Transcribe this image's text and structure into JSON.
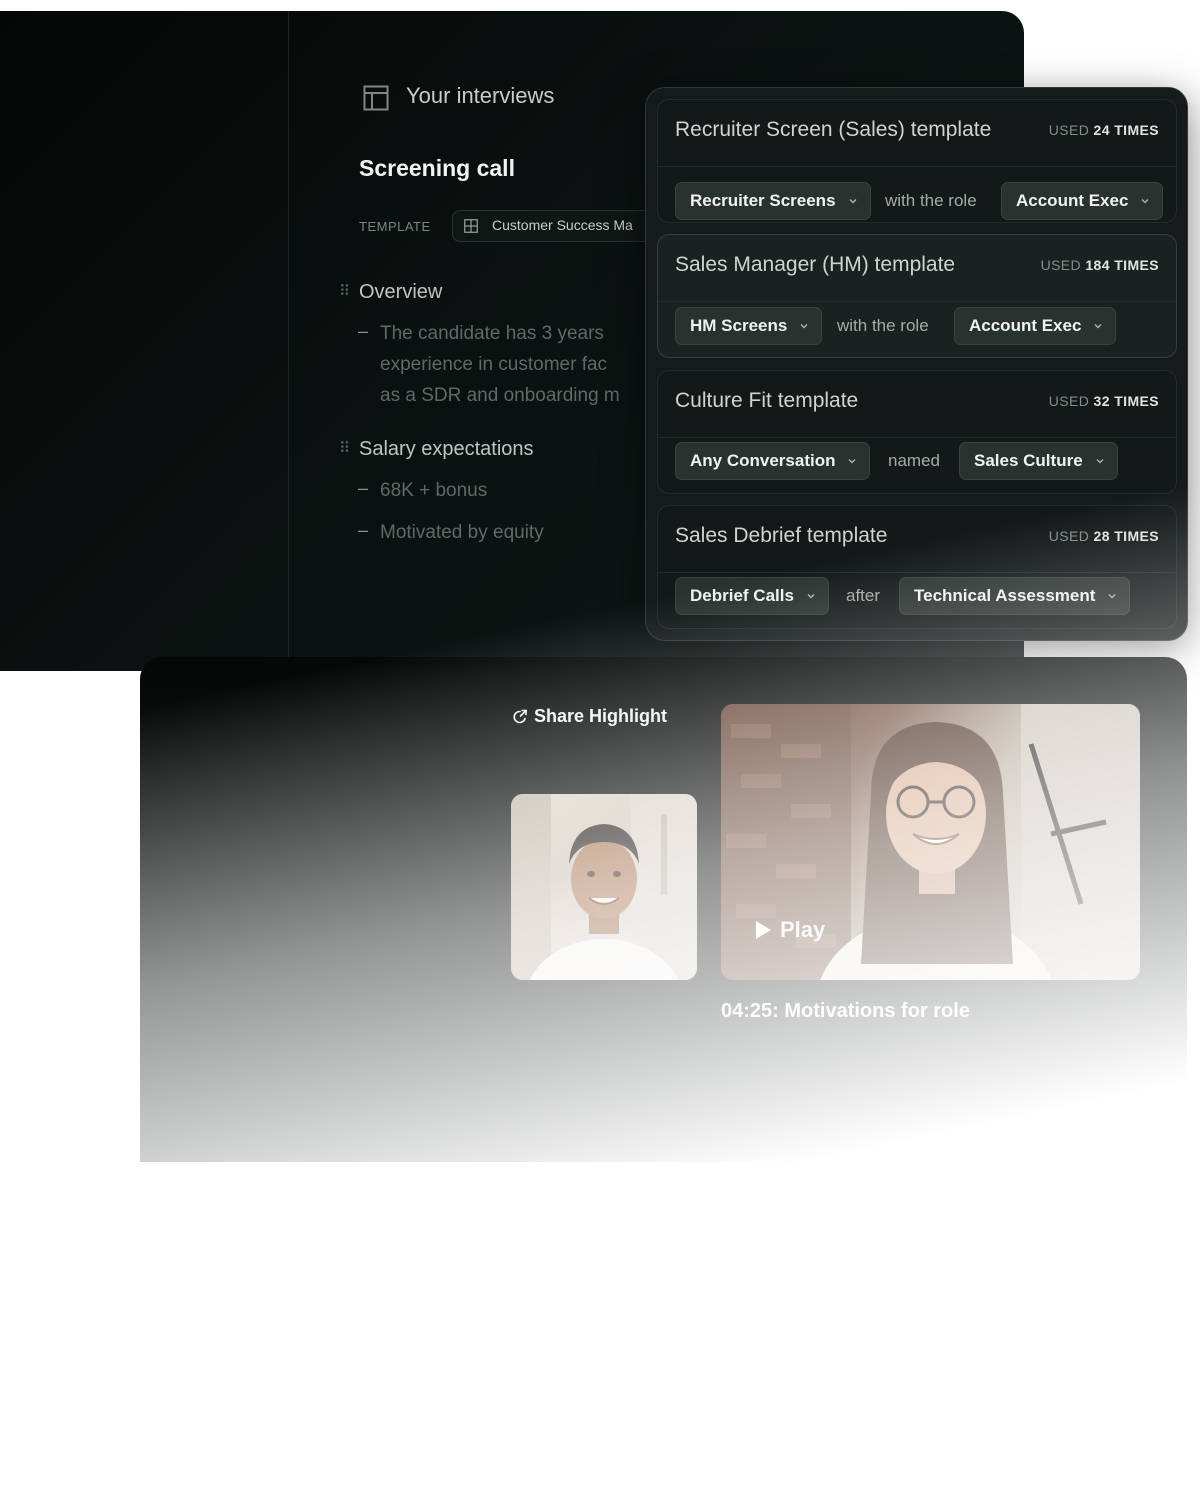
{
  "interview_panel": {
    "header_title": "Your interviews",
    "call_title": "Screening call",
    "template_label": "TEMPLATE",
    "template_value": "Customer Success Ma",
    "sections": [
      {
        "heading": "Overview",
        "bullets": [
          "The candidate has 3 years",
          "experience in customer fac",
          "as a SDR and onboarding m"
        ]
      },
      {
        "heading": "Salary expectations",
        "bullets": [
          "68K + bonus",
          "Motivated by equity"
        ]
      }
    ]
  },
  "templates": [
    {
      "name": "Recruiter Screen (Sales) template",
      "used_prefix": "USED",
      "used_count": "24 TIMES",
      "source": "Recruiter Screens",
      "connector": "with the role",
      "target": "Account Exec"
    },
    {
      "name": "Sales Manager (HM)  template",
      "used_prefix": "USED",
      "used_count": "184 TIMES",
      "source": "HM Screens",
      "connector": "with the role",
      "target": "Account Exec"
    },
    {
      "name": "Culture Fit template",
      "used_prefix": "USED",
      "used_count": "32 TIMES",
      "source": "Any Conversation",
      "connector": "named",
      "target": "Sales Culture"
    },
    {
      "name": "Sales Debrief template",
      "used_prefix": "USED",
      "used_count": "28 TIMES",
      "source": "Debrief Calls",
      "connector": "after",
      "target": "Technical Assessment"
    }
  ],
  "highlight": {
    "share_label": "Share Highlight",
    "play_label": "Play",
    "clip_title": "04:25: Motivations for role"
  },
  "icons": {
    "interviews": "layout-icon",
    "template": "table-icon",
    "share": "share-arrow-icon",
    "play": "play-icon",
    "chevron": "chevron-down-icon",
    "drag": "drag-handle-icon"
  },
  "colors": {
    "background_dark": "#0a1110",
    "card": "#141b1a",
    "pill": "#2a3230",
    "text_primary": "#f0f2f0",
    "text_muted": "#5f6966"
  }
}
